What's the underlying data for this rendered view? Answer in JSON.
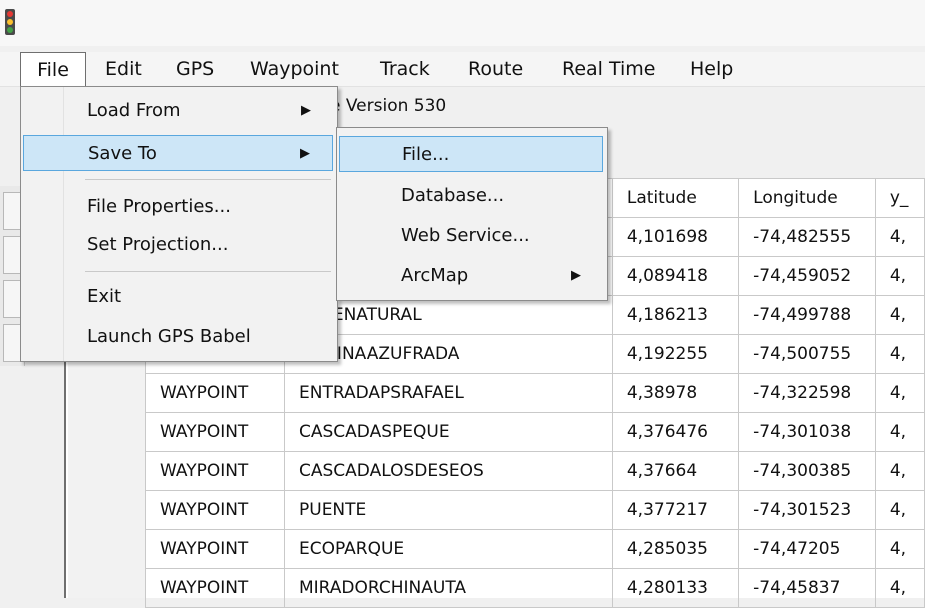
{
  "menubar": {
    "items": [
      "File",
      "Edit",
      "GPS",
      "Waypoint",
      "Track",
      "Route",
      "Real Time",
      "Help"
    ]
  },
  "version_text": "e Version 530",
  "file_menu": {
    "items": [
      {
        "label": "Load From",
        "arrow": "▶"
      },
      {
        "label": "Save To",
        "arrow": "▶"
      },
      {
        "label": "File Properties..."
      },
      {
        "label": "Set Projection..."
      },
      {
        "label": "Exit"
      },
      {
        "label": "Launch GPS Babel"
      }
    ]
  },
  "save_submenu": {
    "items": [
      {
        "label": "File..."
      },
      {
        "label": "Database..."
      },
      {
        "label": "Web Service..."
      },
      {
        "label": "ArcMap",
        "arrow": "▶"
      }
    ]
  },
  "grid": {
    "columns": [
      "",
      "",
      "Latitude",
      "Longitude",
      "y_"
    ],
    "rows": [
      [
        "",
        "",
        "4,101698",
        "-74,482555",
        "4,"
      ],
      [
        "",
        "",
        "4,089418",
        "-74,459052",
        "4,"
      ],
      [
        "",
        "ENTENATURAL",
        "4,186213",
        "-74,499788",
        "4,"
      ],
      [
        "WAYPOINT",
        "PISCINAAZUFRADA",
        "4,192255",
        "-74,500755",
        "4,"
      ],
      [
        "WAYPOINT",
        "ENTRADAPSRAFAEL",
        "4,38978",
        "-74,322598",
        "4,"
      ],
      [
        "WAYPOINT",
        "CASCADASPEQUE",
        "4,376476",
        "-74,301038",
        "4,"
      ],
      [
        "WAYPOINT",
        "CASCADALOSDESEOS",
        "4,37664",
        "-74,300385",
        "4,"
      ],
      [
        "WAYPOINT",
        "PUENTE",
        "4,377217",
        "-74,301523",
        "4,"
      ],
      [
        "WAYPOINT",
        "ECOPARQUE",
        "4,285035",
        "-74,47205",
        "4,"
      ],
      [
        "WAYPOINT",
        "MIRADORCHINAUTA",
        "4,280133",
        "-74,45837",
        "4,"
      ]
    ]
  },
  "icons": {
    "app": "traffic-light-icon",
    "submenu_arrow": "triangle-right-icon"
  },
  "colors": {
    "highlight_bg": "#cde6f7",
    "highlight_border": "#5aa7de",
    "menu_bg": "#f2f2f2"
  }
}
